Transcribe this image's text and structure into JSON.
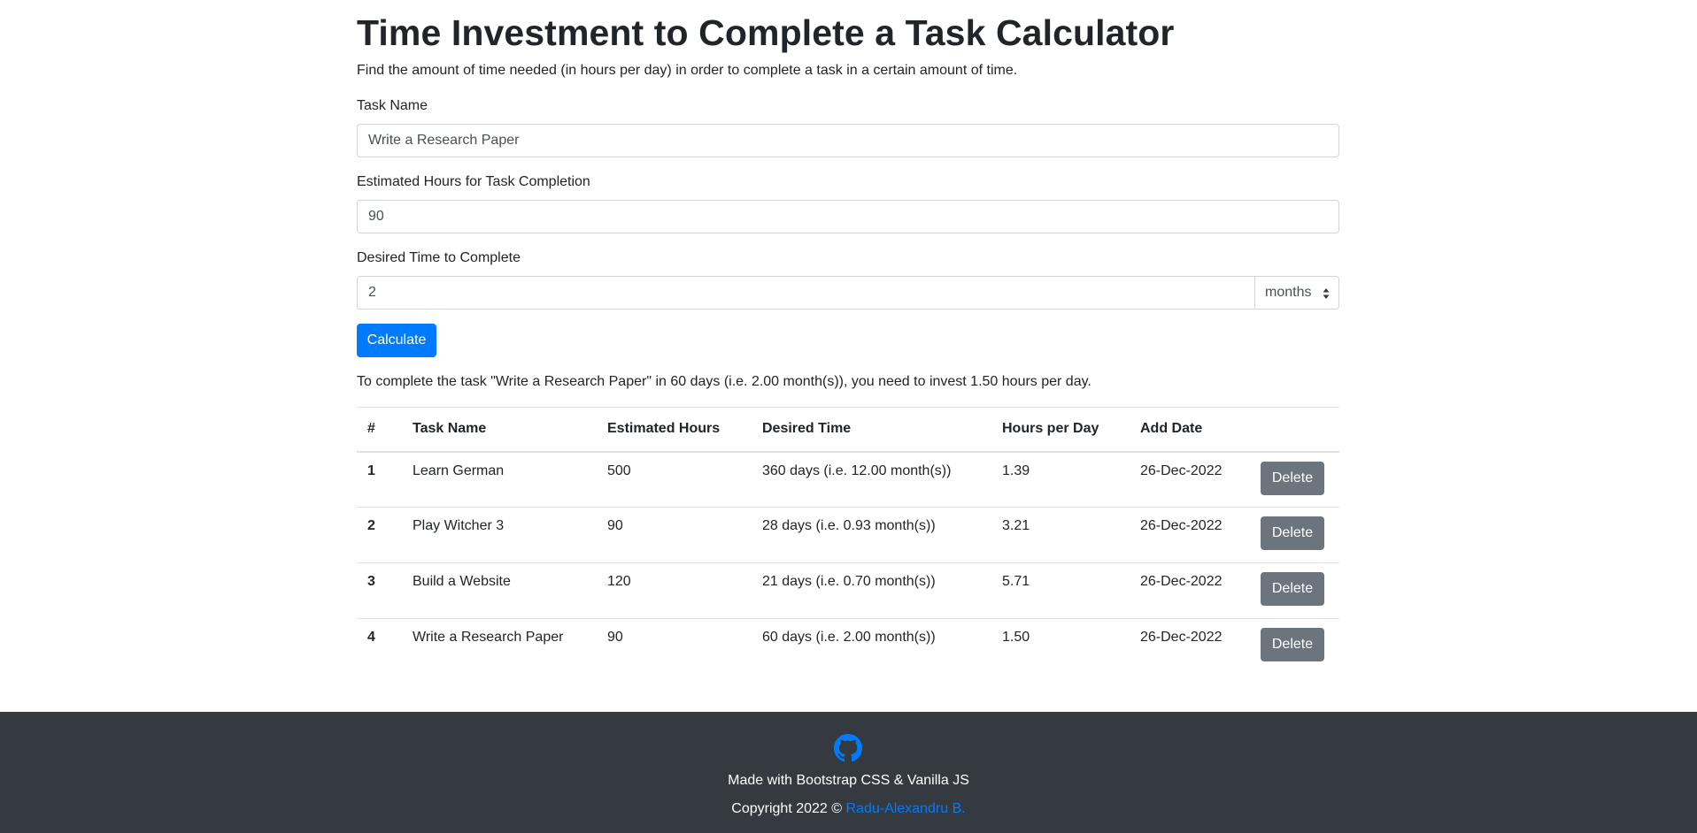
{
  "page": {
    "title": "Time Investment to Complete a Task Calculator",
    "subtitle": "Find the amount of time needed (in hours per day) in order to complete a task in a certain amount of time."
  },
  "form": {
    "task_name_label": "Task Name",
    "task_name_value": "Write a Research Paper",
    "hours_label": "Estimated Hours for Task Completion",
    "hours_value": "90",
    "desired_label": "Desired Time to Complete",
    "desired_value": "2",
    "unit_selected": "months",
    "calculate_label": "Calculate"
  },
  "result_text": "To complete the task \"Write a Research Paper\" in 60 days (i.e. 2.00 month(s)), you need to invest 1.50 hours per day.",
  "table": {
    "headers": [
      "#",
      "Task Name",
      "Estimated Hours",
      "Desired Time",
      "Hours per Day",
      "Add Date",
      ""
    ],
    "rows": [
      {
        "num": "1",
        "task": "Learn German",
        "hours": "500",
        "desired": "360 days (i.e. 12.00 month(s))",
        "per_day": "1.39",
        "date": "26-Dec-2022",
        "action": "Delete"
      },
      {
        "num": "2",
        "task": "Play Witcher 3",
        "hours": "90",
        "desired": "28 days (i.e. 0.93 month(s))",
        "per_day": "3.21",
        "date": "26-Dec-2022",
        "action": "Delete"
      },
      {
        "num": "3",
        "task": "Build a Website",
        "hours": "120",
        "desired": "21 days (i.e. 0.70 month(s))",
        "per_day": "5.71",
        "date": "26-Dec-2022",
        "action": "Delete"
      },
      {
        "num": "4",
        "task": "Write a Research Paper",
        "hours": "90",
        "desired": "60 days (i.e. 2.00 month(s))",
        "per_day": "1.50",
        "date": "26-Dec-2022",
        "action": "Delete"
      }
    ]
  },
  "footer": {
    "icon": "github-icon",
    "made_with": "Made with Bootstrap CSS & Vanilla JS",
    "copyright": "Copyright 2022 © ",
    "author": "Radu-Alexandru B."
  },
  "colors": {
    "primary": "#007bff",
    "secondary": "#6c757d",
    "footer_bg": "#343a40"
  }
}
